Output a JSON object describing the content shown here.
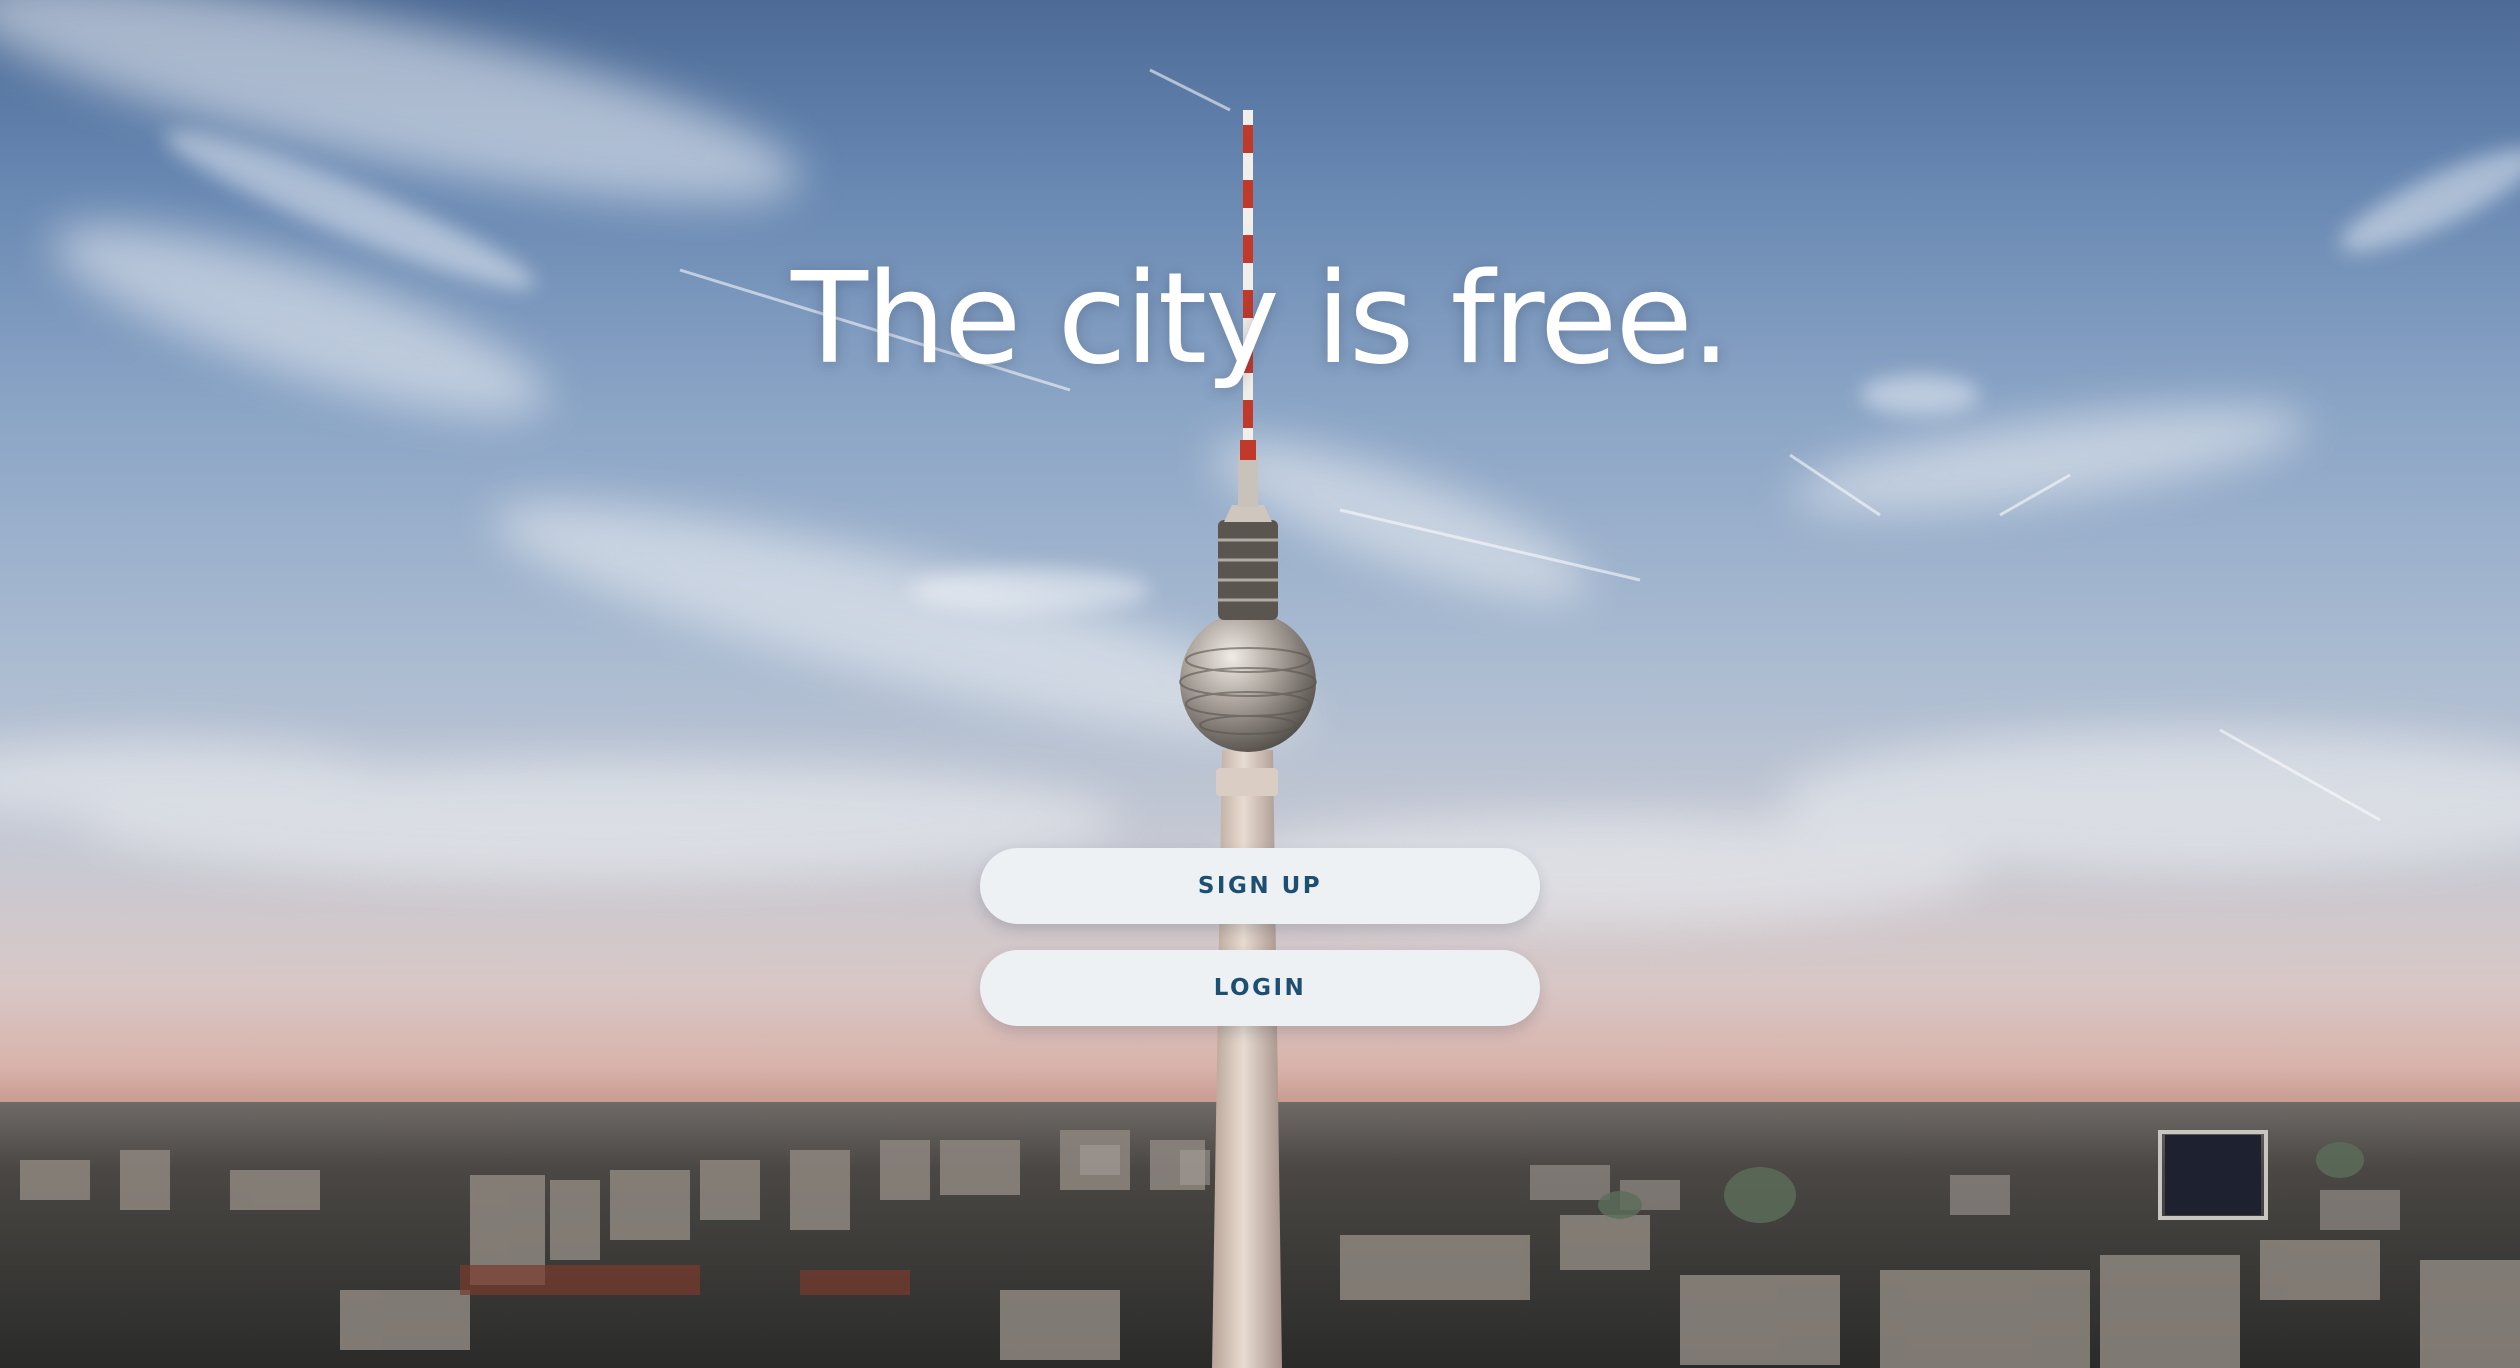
{
  "hero": {
    "headline": "The city is free."
  },
  "actions": {
    "signup_label": "SIGN UP",
    "login_label": "LOGIN"
  },
  "colors": {
    "button_background": "#eef1f4",
    "button_text": "#1d4f73",
    "headline_text": "#ffffff"
  }
}
